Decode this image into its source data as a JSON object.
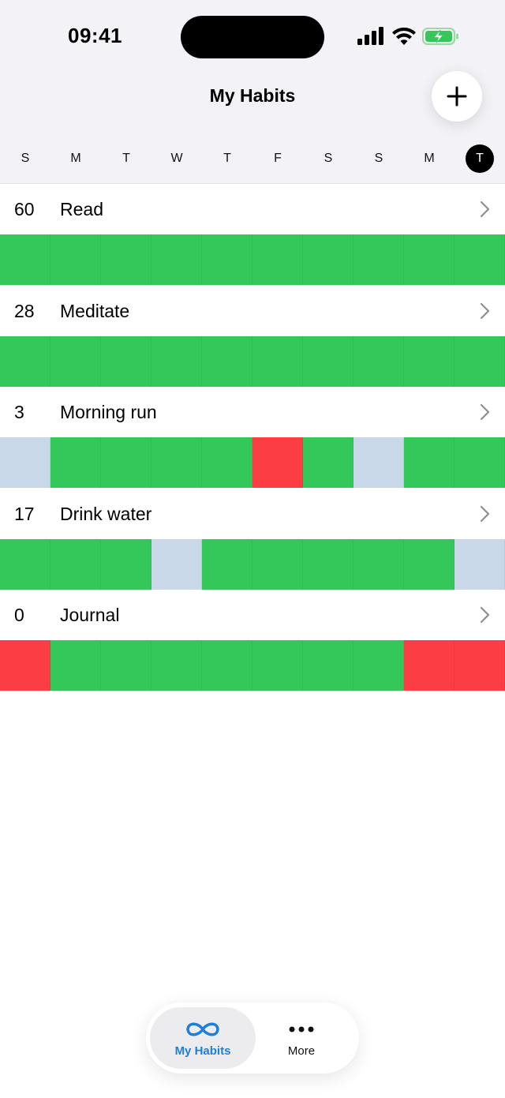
{
  "status_bar": {
    "time": "09:41"
  },
  "header": {
    "title": "My Habits"
  },
  "days": [
    "S",
    "M",
    "T",
    "W",
    "T",
    "F",
    "S",
    "S",
    "M",
    "T"
  ],
  "today_index": 9,
  "colors": {
    "done": "#34c759",
    "missed": "#fc3d43",
    "skipped": "#c8d8e8",
    "accent": "#1e7fd9"
  },
  "habits": [
    {
      "streak": "60",
      "name": "Read",
      "days": [
        "done",
        "done",
        "done",
        "done",
        "done",
        "done",
        "done",
        "done",
        "done",
        "done"
      ]
    },
    {
      "streak": "28",
      "name": "Meditate",
      "days": [
        "done",
        "done",
        "done",
        "done",
        "done",
        "done",
        "done",
        "done",
        "done",
        "done"
      ]
    },
    {
      "streak": "3",
      "name": "Morning run",
      "days": [
        "skipped",
        "done",
        "done",
        "done",
        "done",
        "missed",
        "done",
        "skipped",
        "done",
        "done"
      ]
    },
    {
      "streak": "17",
      "name": "Drink water",
      "days": [
        "done",
        "done",
        "done",
        "skipped",
        "done",
        "done",
        "done",
        "done",
        "done",
        "skipped"
      ]
    },
    {
      "streak": "0",
      "name": "Journal",
      "days": [
        "missed",
        "done",
        "done",
        "done",
        "done",
        "done",
        "done",
        "done",
        "missed",
        "missed"
      ]
    }
  ],
  "tabs": [
    {
      "label": "My Habits",
      "icon": "infinity-icon"
    },
    {
      "label": "More",
      "icon": "ellipsis-icon"
    }
  ]
}
